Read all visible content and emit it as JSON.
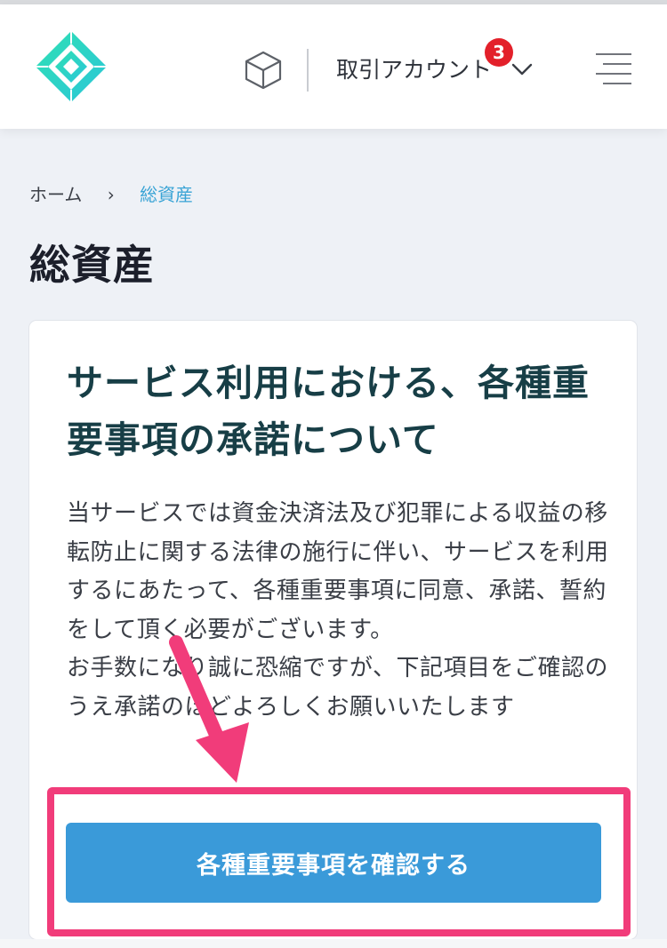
{
  "header": {
    "account_label": "取引アカウント",
    "notification_count": "3",
    "accent_color": "#2fd4c4"
  },
  "breadcrumb": {
    "home": "ホーム",
    "separator": "›",
    "current": "総資産"
  },
  "page": {
    "title": "総資産"
  },
  "card": {
    "title": "サービス利用における、各種重要事項の承諾について",
    "body": "当サービスでは資金決済法及び犯罪による収益の移転防止に関する法律の施行に伴い、サービスを利用するにあたって、各種重要事項に同意、承諾、誓約をして頂く必要がございます。\nお手数になり誠に恐縮ですが、下記項目をご確認のうえ承諾のほどよろしくお願いいたします",
    "button_label": "各種重要事項を確認する",
    "button_color": "#3a9ad9",
    "highlight_color": "#f13c7a"
  },
  "icons": {
    "logo": "diamond-logo-icon",
    "cube": "cube-icon",
    "chevron": "chevron-down-icon",
    "menu": "hamburger-menu-icon",
    "arrow": "arrow-annotation-icon"
  }
}
